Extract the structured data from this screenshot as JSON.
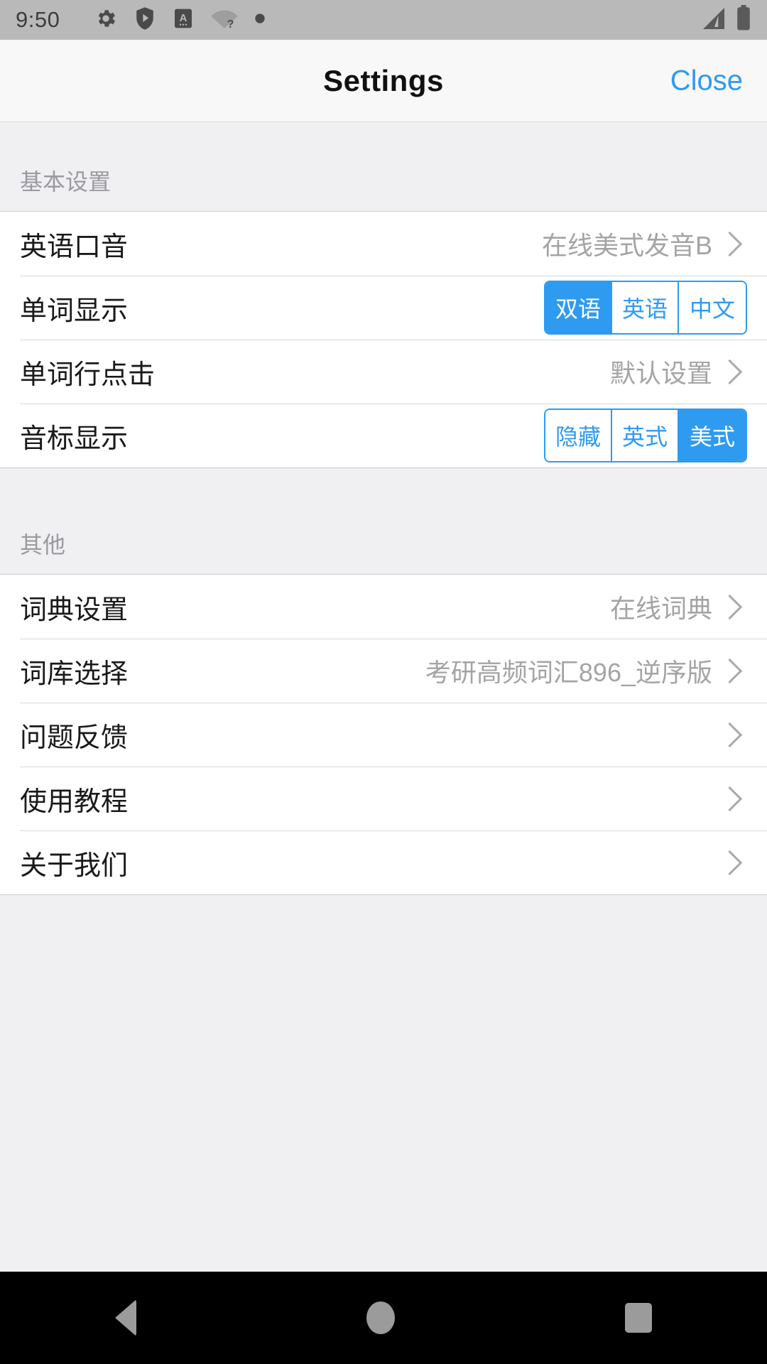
{
  "status_bar": {
    "time": "9:50",
    "left_icons": [
      "gear-icon",
      "play-shield-icon",
      "app-a-icon",
      "wifi-question-icon",
      "dot-icon"
    ],
    "right_icons": [
      "cellular-signal-icon",
      "battery-full-icon"
    ]
  },
  "header": {
    "title": "Settings",
    "close_label": "Close",
    "accent_color": "#2e9bf0"
  },
  "sections": [
    {
      "title": "基本设置",
      "rows": [
        {
          "label": "英语口音",
          "type": "value",
          "value": "在线美式发音B"
        },
        {
          "label": "单词显示",
          "type": "segmented",
          "options": [
            "双语",
            "英语",
            "中文"
          ],
          "selected": 0
        },
        {
          "label": "单词行点击",
          "type": "value",
          "value": "默认设置"
        },
        {
          "label": "音标显示",
          "type": "segmented",
          "options": [
            "隐藏",
            "英式",
            "美式"
          ],
          "selected": 2
        }
      ]
    },
    {
      "title": "其他",
      "rows": [
        {
          "label": "词典设置",
          "type": "value",
          "value": "在线词典"
        },
        {
          "label": "词库选择",
          "type": "value",
          "value": "考研高频词汇896_逆序版"
        },
        {
          "label": "问题反馈",
          "type": "chevron",
          "value": ""
        },
        {
          "label": "使用教程",
          "type": "chevron",
          "value": ""
        },
        {
          "label": "关于我们",
          "type": "chevron",
          "value": ""
        }
      ]
    }
  ],
  "nav_bar": {
    "back_label": "back-icon",
    "home_label": "home-icon",
    "recents_label": "recents-icon"
  }
}
